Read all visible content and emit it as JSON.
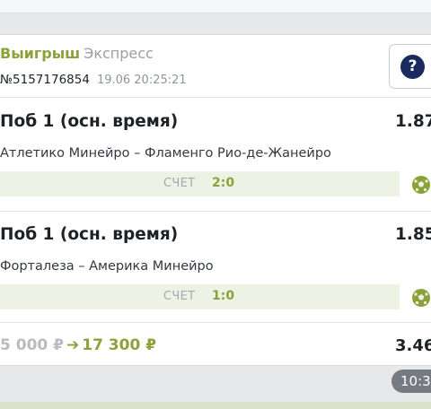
{
  "header": {
    "status": "Выигрыш",
    "bet_type": "Экспресс",
    "ticket_number": "№5157176854",
    "datetime": "19.06 20:25:21",
    "help_icon": "question-circle-icon"
  },
  "bets": [
    {
      "market": "Поб 1 (осн. время)",
      "odds": "1.87",
      "teams": "Атлетико Минейро – Фламенго Рио-де-Жанейро",
      "score_label": "СЧЕТ",
      "score": "2:0",
      "sport_icon": "soccer-ball-icon"
    },
    {
      "market": "Поб 1 (осн. время)",
      "odds": "1.85",
      "teams": "Форталеза – Америка Минейро",
      "score_label": "СЧЕТ",
      "score": "1:0",
      "sport_icon": "soccer-ball-icon"
    }
  ],
  "summary": {
    "stake": "5 000 ₽",
    "payout": "17 300 ₽",
    "total_odds": "3.46"
  },
  "time": "10:3",
  "colors": {
    "accent_green": "#8ba23a",
    "help_navy": "#1b2a5e"
  }
}
